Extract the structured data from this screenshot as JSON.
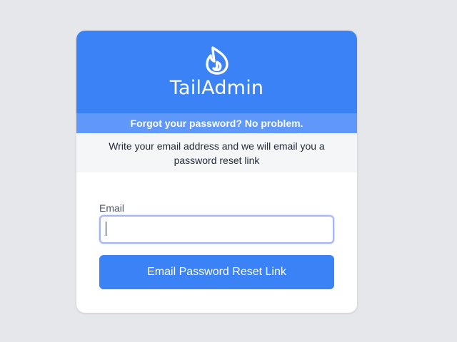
{
  "brand": {
    "name": "TailAdmin",
    "logo_icon": "flame-icon"
  },
  "notice": {
    "title": "Forgot your password? No problem.",
    "message": "Write your email address and we will email you a password reset link"
  },
  "form": {
    "email_label": "Email",
    "email_value": "",
    "submit_label": "Email Password Reset Link"
  },
  "colors": {
    "page_bg": "#e5e7eb",
    "primary": "#3b82f6",
    "subhead_bg": "#5f98f8",
    "info_bg": "#f5f6f8"
  }
}
